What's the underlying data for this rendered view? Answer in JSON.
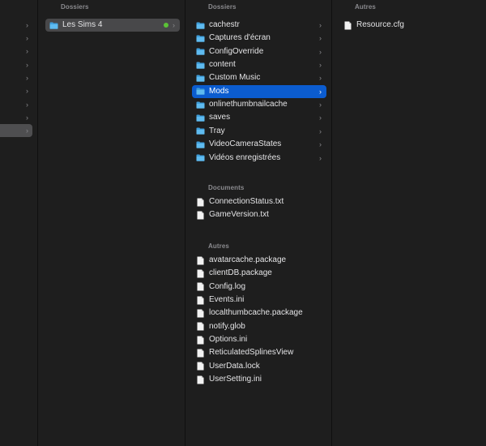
{
  "colors": {
    "accent": "#0b5ccf",
    "green_tag": "#5bc236",
    "folder": "#56b4ea"
  },
  "col1": {
    "header": "Dossiers",
    "items": [
      {
        "label": "Les Sims 4",
        "icon": "folder-icon",
        "tag": "green"
      }
    ]
  },
  "col2": {
    "headers": {
      "folders": "Dossiers",
      "documents": "Documents",
      "others": "Autres"
    },
    "folders": [
      {
        "label": "cachestr"
      },
      {
        "label": "Captures d'écran"
      },
      {
        "label": "ConfigOverride"
      },
      {
        "label": "content"
      },
      {
        "label": "Custom Music"
      },
      {
        "label": "Mods"
      },
      {
        "label": "onlinethumbnailcache"
      },
      {
        "label": "saves"
      },
      {
        "label": "Tray"
      },
      {
        "label": "VideoCameraStates"
      },
      {
        "label": "Vidéos enregistrées"
      }
    ],
    "documents": [
      {
        "label": "ConnectionStatus.txt"
      },
      {
        "label": "GameVersion.txt"
      }
    ],
    "others": [
      {
        "label": "avatarcache.package"
      },
      {
        "label": "clientDB.package"
      },
      {
        "label": "Config.log"
      },
      {
        "label": "Events.ini"
      },
      {
        "label": "localthumbcache.package"
      },
      {
        "label": "notify.glob"
      },
      {
        "label": "Options.ini"
      },
      {
        "label": "ReticulatedSplinesView"
      },
      {
        "label": "UserData.lock"
      },
      {
        "label": "UserSetting.ini"
      }
    ]
  },
  "col3": {
    "header": "Autres",
    "files": [
      {
        "label": "Resource.cfg"
      }
    ]
  }
}
